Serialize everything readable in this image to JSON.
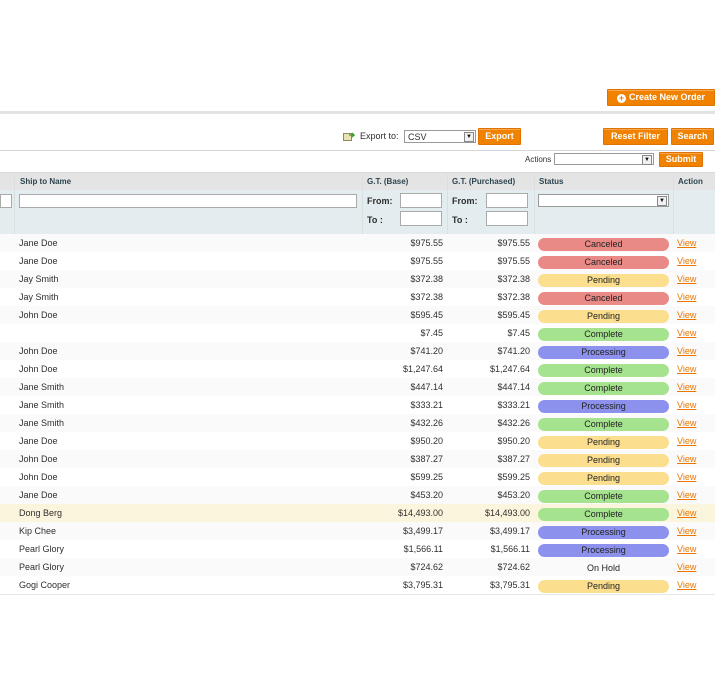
{
  "toolbar": {
    "create_new_order": "Create New Order",
    "export_label": "Export to:",
    "export_format": "CSV",
    "export_button": "Export",
    "reset_filter": "Reset Filter",
    "search": "Search",
    "actions_label": "Actions",
    "submit": "Submit"
  },
  "columns": {
    "ship_to": "Ship to Name",
    "gt_base": "G.T. (Base)",
    "gt_purchased": "G.T. (Purchased)",
    "status": "Status",
    "action": "Action"
  },
  "filters": {
    "from": "From:",
    "to": "To :"
  },
  "status_colors": {
    "Canceled": "#e98a87",
    "Pending": "#fbdf8e",
    "Complete": "#a6e38f",
    "Processing": "#8c91ee",
    "On Hold": "transparent"
  },
  "rows": [
    {
      "name": "Jane Doe",
      "base": "$975.55",
      "purchased": "$975.55",
      "status": "Canceled",
      "action": "View"
    },
    {
      "name": "Jane Doe",
      "base": "$975.55",
      "purchased": "$975.55",
      "status": "Canceled",
      "action": "View"
    },
    {
      "name": "Jay Smith",
      "base": "$372.38",
      "purchased": "$372.38",
      "status": "Pending",
      "action": "View"
    },
    {
      "name": "Jay Smith",
      "base": "$372.38",
      "purchased": "$372.38",
      "status": "Canceled",
      "action": "View"
    },
    {
      "name": "John Doe",
      "base": "$595.45",
      "purchased": "$595.45",
      "status": "Pending",
      "action": "View"
    },
    {
      "name": "",
      "base": "$7.45",
      "purchased": "$7.45",
      "status": "Complete",
      "action": "View"
    },
    {
      "name": "John Doe",
      "base": "$741.20",
      "purchased": "$741.20",
      "status": "Processing",
      "action": "View"
    },
    {
      "name": "John Doe",
      "base": "$1,247.64",
      "purchased": "$1,247.64",
      "status": "Complete",
      "action": "View"
    },
    {
      "name": "Jane Smith",
      "base": "$447.14",
      "purchased": "$447.14",
      "status": "Complete",
      "action": "View"
    },
    {
      "name": "Jane Smith",
      "base": "$333.21",
      "purchased": "$333.21",
      "status": "Processing",
      "action": "View"
    },
    {
      "name": "Jane Smith",
      "base": "$432.26",
      "purchased": "$432.26",
      "status": "Complete",
      "action": "View"
    },
    {
      "name": "Jane Doe",
      "base": "$950.20",
      "purchased": "$950.20",
      "status": "Pending",
      "action": "View"
    },
    {
      "name": "John Doe",
      "base": "$387.27",
      "purchased": "$387.27",
      "status": "Pending",
      "action": "View"
    },
    {
      "name": "John Doe",
      "base": "$599.25",
      "purchased": "$599.25",
      "status": "Pending",
      "action": "View"
    },
    {
      "name": "Jane Doe",
      "base": "$453.20",
      "purchased": "$453.20",
      "status": "Complete",
      "action": "View"
    },
    {
      "name": "Dong Berg",
      "base": "$14,493.00",
      "purchased": "$14,493.00",
      "status": "Complete",
      "action": "View",
      "highlight": true
    },
    {
      "name": "Kip Chee",
      "base": "$3,499.17",
      "purchased": "$3,499.17",
      "status": "Processing",
      "action": "View"
    },
    {
      "name": "Pearl Glory",
      "base": "$1,566.11",
      "purchased": "$1,566.11",
      "status": "Processing",
      "action": "View"
    },
    {
      "name": "Pearl Glory",
      "base": "$724.62",
      "purchased": "$724.62",
      "status": "On Hold",
      "action": "View"
    },
    {
      "name": "Gogi Cooper",
      "base": "$3,795.31",
      "purchased": "$3,795.31",
      "status": "Pending",
      "action": "View"
    }
  ]
}
